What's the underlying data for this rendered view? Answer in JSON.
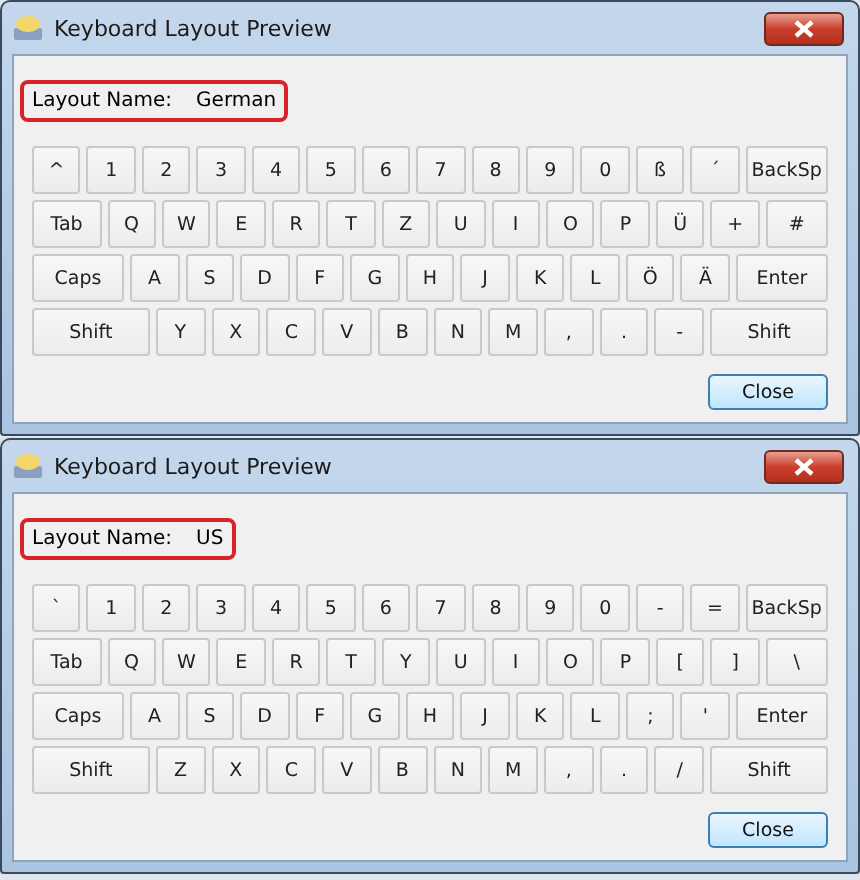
{
  "windows": [
    {
      "title": "Keyboard Layout Preview",
      "layout_label": "Layout Name:",
      "layout_name": "German",
      "highlighted": true,
      "keyboard_rows": [
        {
          "keys": [
            {
              "label": "^",
              "kind": "key"
            },
            {
              "label": "1",
              "kind": "key"
            },
            {
              "label": "2",
              "kind": "key"
            },
            {
              "label": "3",
              "kind": "key"
            },
            {
              "label": "4",
              "kind": "key"
            },
            {
              "label": "5",
              "kind": "key"
            },
            {
              "label": "6",
              "kind": "key"
            },
            {
              "label": "7",
              "kind": "key"
            },
            {
              "label": "8",
              "kind": "key"
            },
            {
              "label": "9",
              "kind": "key"
            },
            {
              "label": "0",
              "kind": "key"
            },
            {
              "label": "ß",
              "kind": "key"
            },
            {
              "label": "´",
              "kind": "key"
            },
            {
              "label": "BackSp",
              "kind": "backspace"
            }
          ]
        },
        {
          "keys": [
            {
              "label": "Tab",
              "kind": "tab"
            },
            {
              "label": "Q",
              "kind": "key"
            },
            {
              "label": "W",
              "kind": "key"
            },
            {
              "label": "E",
              "kind": "key"
            },
            {
              "label": "R",
              "kind": "key"
            },
            {
              "label": "T",
              "kind": "key"
            },
            {
              "label": "Z",
              "kind": "key"
            },
            {
              "label": "U",
              "kind": "key"
            },
            {
              "label": "I",
              "kind": "key"
            },
            {
              "label": "O",
              "kind": "key"
            },
            {
              "label": "P",
              "kind": "key"
            },
            {
              "label": "Ü",
              "kind": "key"
            },
            {
              "label": "+",
              "kind": "key"
            },
            {
              "label": "#",
              "kind": "last"
            }
          ]
        },
        {
          "keys": [
            {
              "label": "Caps",
              "kind": "caps"
            },
            {
              "label": "A",
              "kind": "key"
            },
            {
              "label": "S",
              "kind": "key"
            },
            {
              "label": "D",
              "kind": "key"
            },
            {
              "label": "F",
              "kind": "key"
            },
            {
              "label": "G",
              "kind": "key"
            },
            {
              "label": "H",
              "kind": "key"
            },
            {
              "label": "J",
              "kind": "key"
            },
            {
              "label": "K",
              "kind": "key"
            },
            {
              "label": "L",
              "kind": "key"
            },
            {
              "label": "Ö",
              "kind": "key"
            },
            {
              "label": "Ä",
              "kind": "key"
            },
            {
              "label": "Enter",
              "kind": "enter"
            }
          ]
        },
        {
          "keys": [
            {
              "label": "Shift",
              "kind": "shift"
            },
            {
              "label": "Y",
              "kind": "key"
            },
            {
              "label": "X",
              "kind": "key"
            },
            {
              "label": "C",
              "kind": "key"
            },
            {
              "label": "V",
              "kind": "key"
            },
            {
              "label": "B",
              "kind": "key"
            },
            {
              "label": "N",
              "kind": "key"
            },
            {
              "label": "M",
              "kind": "key"
            },
            {
              "label": ",",
              "kind": "key"
            },
            {
              "label": ".",
              "kind": "key"
            },
            {
              "label": "-",
              "kind": "key"
            },
            {
              "label": "Shift",
              "kind": "shift"
            }
          ]
        }
      ],
      "close_button": "Close"
    },
    {
      "title": "Keyboard Layout Preview",
      "layout_label": "Layout Name:",
      "layout_name": "US",
      "highlighted": true,
      "keyboard_rows": [
        {
          "keys": [
            {
              "label": "`",
              "kind": "key"
            },
            {
              "label": "1",
              "kind": "key"
            },
            {
              "label": "2",
              "kind": "key"
            },
            {
              "label": "3",
              "kind": "key"
            },
            {
              "label": "4",
              "kind": "key"
            },
            {
              "label": "5",
              "kind": "key"
            },
            {
              "label": "6",
              "kind": "key"
            },
            {
              "label": "7",
              "kind": "key"
            },
            {
              "label": "8",
              "kind": "key"
            },
            {
              "label": "9",
              "kind": "key"
            },
            {
              "label": "0",
              "kind": "key"
            },
            {
              "label": "-",
              "kind": "key"
            },
            {
              "label": "=",
              "kind": "key"
            },
            {
              "label": "BackSp",
              "kind": "backspace"
            }
          ]
        },
        {
          "keys": [
            {
              "label": "Tab",
              "kind": "tab"
            },
            {
              "label": "Q",
              "kind": "key"
            },
            {
              "label": "W",
              "kind": "key"
            },
            {
              "label": "E",
              "kind": "key"
            },
            {
              "label": "R",
              "kind": "key"
            },
            {
              "label": "T",
              "kind": "key"
            },
            {
              "label": "Y",
              "kind": "key"
            },
            {
              "label": "U",
              "kind": "key"
            },
            {
              "label": "I",
              "kind": "key"
            },
            {
              "label": "O",
              "kind": "key"
            },
            {
              "label": "P",
              "kind": "key"
            },
            {
              "label": "[",
              "kind": "key"
            },
            {
              "label": "]",
              "kind": "key"
            },
            {
              "label": "\\",
              "kind": "last"
            }
          ]
        },
        {
          "keys": [
            {
              "label": "Caps",
              "kind": "caps"
            },
            {
              "label": "A",
              "kind": "key"
            },
            {
              "label": "S",
              "kind": "key"
            },
            {
              "label": "D",
              "kind": "key"
            },
            {
              "label": "F",
              "kind": "key"
            },
            {
              "label": "G",
              "kind": "key"
            },
            {
              "label": "H",
              "kind": "key"
            },
            {
              "label": "J",
              "kind": "key"
            },
            {
              "label": "K",
              "kind": "key"
            },
            {
              "label": "L",
              "kind": "key"
            },
            {
              "label": ";",
              "kind": "key"
            },
            {
              "label": "'",
              "kind": "key"
            },
            {
              "label": "Enter",
              "kind": "enter"
            }
          ]
        },
        {
          "keys": [
            {
              "label": "Shift",
              "kind": "shift"
            },
            {
              "label": "Z",
              "kind": "key"
            },
            {
              "label": "X",
              "kind": "key"
            },
            {
              "label": "C",
              "kind": "key"
            },
            {
              "label": "V",
              "kind": "key"
            },
            {
              "label": "B",
              "kind": "key"
            },
            {
              "label": "N",
              "kind": "key"
            },
            {
              "label": "M",
              "kind": "key"
            },
            {
              "label": ",",
              "kind": "key"
            },
            {
              "label": ".",
              "kind": "key"
            },
            {
              "label": "/",
              "kind": "key"
            },
            {
              "label": "Shift",
              "kind": "shift"
            }
          ]
        }
      ],
      "close_button": "Close"
    }
  ]
}
